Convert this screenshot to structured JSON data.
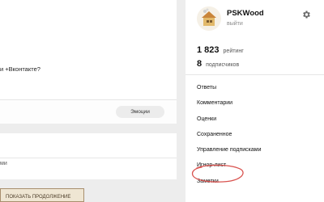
{
  "feed": {
    "question_partial": "и +Вконтакте?",
    "emotions_label": "Эмоции",
    "comments_partial": "ми",
    "promo_text": "ПОКАЗАТЬ ПРОДОЛЖЕНИЕ"
  },
  "profile": {
    "username": "PSKWood",
    "logout_label": "выйти",
    "rating_value": "1 823",
    "rating_label": "рейтинг",
    "subscribers_value": "8",
    "subscribers_label": "подписчиков",
    "gear_icon": "gear-icon",
    "avatar_icon": "avatar"
  },
  "menu": {
    "items": [
      {
        "label": "Ответы"
      },
      {
        "label": "Комментарии"
      },
      {
        "label": "Оценки"
      },
      {
        "label": "Сохраненное"
      },
      {
        "label": "Управление подписками"
      },
      {
        "label": "Игнор-лист"
      },
      {
        "label": "Заметки"
      }
    ]
  },
  "colors": {
    "accent_ring": "#d9534f",
    "background": "#ededed"
  }
}
